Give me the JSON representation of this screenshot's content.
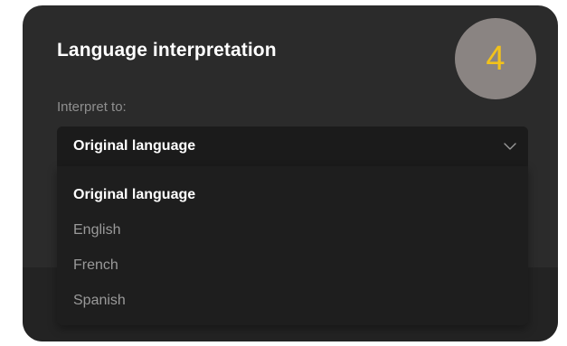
{
  "dialog": {
    "title": "Language interpretation",
    "step_badge": "4",
    "field_label": "Interpret to:",
    "select": {
      "value": "Original language",
      "icon": "chevron-down-icon"
    },
    "options": [
      {
        "label": "Original language",
        "selected": true
      },
      {
        "label": "English",
        "selected": false
      },
      {
        "label": "French",
        "selected": false
      },
      {
        "label": "Spanish",
        "selected": false
      }
    ]
  },
  "colors": {
    "dialog_bg": "#2b2b2b",
    "select_bg": "#1b1b1b",
    "badge_bg": "#8a8482",
    "badge_text": "#f2c21b"
  }
}
